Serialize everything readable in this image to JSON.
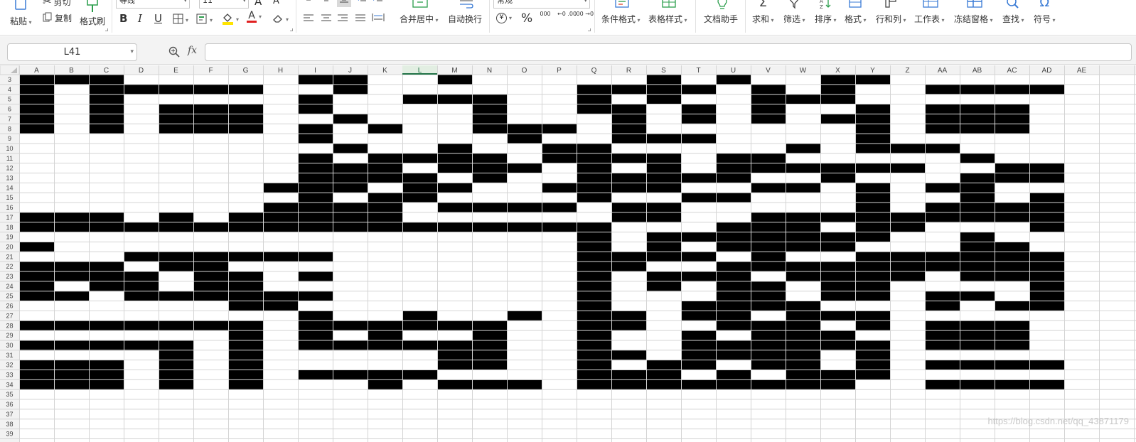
{
  "ribbon": {
    "clipboard": {
      "paste": "粘贴",
      "cut": "剪切",
      "copy": "复制",
      "format_painter": "格式刷"
    },
    "font": {
      "name": "等线",
      "size": "11",
      "bold": "B",
      "italic": "I",
      "underline": "U",
      "grow": "A",
      "shrink": "A",
      "color_letter": "A"
    },
    "align": {
      "merge_center": "合并居中",
      "wrap": "自动换行"
    },
    "number": {
      "format": "常规",
      "percent": "%",
      "thousands": "000",
      "inc_decimal": "←0 .00",
      "dec_decimal": ".00 →0"
    },
    "styles": {
      "conditional": "条件格式",
      "table_style": "表格样式"
    },
    "assistant": "文档助手",
    "editing": {
      "sum": "求和",
      "filter": "筛选",
      "sort": "排序",
      "format": "格式",
      "rows_cols": "行和列",
      "worksheet": "工作表",
      "freeze": "冻结窗格",
      "find": "查找",
      "symbol": "符号"
    },
    "accent_color": "#4a7bd0",
    "font_color": "#e02020",
    "fill_color": "#ffe400"
  },
  "formula_bar": {
    "name_box": "L41",
    "fx": "fx",
    "formula": ""
  },
  "sheet": {
    "columns": [
      "A",
      "B",
      "C",
      "D",
      "E",
      "F",
      "G",
      "H",
      "I",
      "J",
      "K",
      "L",
      "M",
      "N",
      "O",
      "P",
      "Q",
      "R",
      "S",
      "T",
      "U",
      "V",
      "W",
      "X",
      "Y",
      "Z",
      "AA",
      "AB",
      "AC",
      "AD",
      "AE"
    ],
    "first_row": 3,
    "last_row": 39,
    "active_column": "L",
    "filled_color": "#000000",
    "empty_color": "#ffffff",
    "grid_color": "#d4d4d4",
    "header_bg": "#f2f2f2",
    "filled_cells": {
      "3": [
        "A",
        "B",
        "C",
        "I",
        "J",
        "M",
        "S",
        "U",
        "X",
        "Y"
      ],
      "4": [
        "A",
        "C",
        "D",
        "E",
        "F",
        "G",
        "J",
        "Q",
        "R",
        "S",
        "T",
        "V",
        "X",
        "AA",
        "AB",
        "AC",
        "AD"
      ],
      "5": [
        "A",
        "C",
        "I",
        "L",
        "M",
        "N",
        "Q",
        "S",
        "V",
        "W",
        "X"
      ],
      "6": [
        "A",
        "C",
        "E",
        "F",
        "G",
        "I",
        "N",
        "Q",
        "R",
        "T",
        "V",
        "Y",
        "AA",
        "AB",
        "AC"
      ],
      "7": [
        "A",
        "C",
        "E",
        "F",
        "G",
        "J",
        "N",
        "R",
        "T",
        "V",
        "X",
        "Y",
        "AA",
        "AB",
        "AC"
      ],
      "8": [
        "A",
        "C",
        "E",
        "F",
        "G",
        "I",
        "K",
        "N",
        "O",
        "P",
        "R",
        "Y",
        "AA",
        "AB",
        "AC"
      ],
      "9": [
        "I",
        "O",
        "R",
        "S",
        "T",
        "Y"
      ],
      "10": [
        "J",
        "M",
        "P",
        "Q",
        "W",
        "Y",
        "Z",
        "AA"
      ],
      "11": [
        "I",
        "K",
        "L",
        "M",
        "N",
        "P",
        "Q",
        "R",
        "S",
        "U",
        "V",
        "AB"
      ],
      "12": [
        "I",
        "J",
        "K",
        "M",
        "N",
        "O",
        "Q",
        "S",
        "U",
        "V",
        "W",
        "X",
        "Y",
        "Z",
        "AC",
        "AD"
      ],
      "13": [
        "I",
        "J",
        "K",
        "L",
        "N",
        "Q",
        "R",
        "S",
        "T",
        "U",
        "X",
        "AB",
        "AC",
        "AD"
      ],
      "14": [
        "H",
        "I",
        "J",
        "L",
        "M",
        "P",
        "Q",
        "R",
        "S",
        "V",
        "W",
        "Y",
        "AA",
        "AB"
      ],
      "15": [
        "I",
        "K",
        "L",
        "Q",
        "T",
        "U",
        "Y",
        "AB",
        "AD"
      ],
      "16": [
        "H",
        "I",
        "J",
        "K",
        "M",
        "N",
        "O",
        "P",
        "R",
        "S",
        "Y",
        "AA",
        "AB",
        "AC",
        "AD"
      ],
      "17": [
        "A",
        "B",
        "C",
        "E",
        "G",
        "H",
        "I",
        "J",
        "K",
        "R",
        "S",
        "V",
        "W",
        "X",
        "Y",
        "Z",
        "AA",
        "AB",
        "AC",
        "AD"
      ],
      "18": [
        "A",
        "B",
        "C",
        "D",
        "E",
        "F",
        "G",
        "H",
        "I",
        "J",
        "K",
        "L",
        "M",
        "N",
        "O",
        "P",
        "Q",
        "U",
        "V",
        "W",
        "Y",
        "Z",
        "AD"
      ],
      "19": [
        "Q",
        "S",
        "T",
        "U",
        "V",
        "W",
        "X",
        "Y",
        "AB"
      ],
      "20": [
        "A",
        "Q",
        "S",
        "U",
        "V",
        "W",
        "X",
        "AB",
        "AC"
      ],
      "21": [
        "D",
        "E",
        "F",
        "G",
        "H",
        "I",
        "Q",
        "R",
        "S",
        "T",
        "V",
        "Y",
        "Z",
        "AA",
        "AB",
        "AC",
        "AD"
      ],
      "22": [
        "A",
        "B",
        "C",
        "E",
        "F",
        "Q",
        "R",
        "U",
        "V",
        "W",
        "X",
        "Y",
        "Z",
        "AA",
        "AB",
        "AC",
        "AD"
      ],
      "23": [
        "A",
        "B",
        "C",
        "D",
        "F",
        "G",
        "I",
        "Q",
        "S",
        "T",
        "U",
        "W",
        "X",
        "Y",
        "Z",
        "AB",
        "AC",
        "AD"
      ],
      "24": [
        "A",
        "C",
        "D",
        "F",
        "G",
        "Q",
        "S",
        "U",
        "V",
        "X",
        "Y",
        "AD"
      ],
      "25": [
        "A",
        "B",
        "D",
        "E",
        "F",
        "G",
        "H",
        "I",
        "Q",
        "U",
        "V",
        "X",
        "Y",
        "AA",
        "AB",
        "AD"
      ],
      "26": [
        "G",
        "H",
        "Q",
        "T",
        "U",
        "V",
        "W",
        "AA",
        "AC",
        "AD"
      ],
      "27": [
        "I",
        "L",
        "O",
        "Q",
        "R",
        "T",
        "U",
        "W",
        "X",
        "Y"
      ],
      "28": [
        "A",
        "B",
        "C",
        "D",
        "E",
        "F",
        "G",
        "I",
        "J",
        "K",
        "L",
        "M",
        "N",
        "Q",
        "R",
        "U",
        "V",
        "W",
        "Y",
        "AA",
        "AB",
        "AC"
      ],
      "29": [
        "G",
        "I",
        "K",
        "N",
        "Q",
        "T",
        "V",
        "W",
        "X",
        "AA",
        "AB",
        "AC"
      ],
      "30": [
        "A",
        "B",
        "C",
        "D",
        "E",
        "G",
        "I",
        "J",
        "K",
        "L",
        "M",
        "N",
        "Q",
        "T",
        "U",
        "V",
        "W",
        "X",
        "Y",
        "AA",
        "AB",
        "AC"
      ],
      "31": [
        "E",
        "G",
        "M",
        "N",
        "Q",
        "R",
        "T",
        "U",
        "V",
        "W",
        "Y"
      ],
      "32": [
        "A",
        "B",
        "C",
        "E",
        "G",
        "M",
        "N",
        "Q",
        "S",
        "T",
        "V",
        "W",
        "Y",
        "AA",
        "AB",
        "AC",
        "AD"
      ],
      "33": [
        "A",
        "B",
        "C",
        "E",
        "G",
        "I",
        "J",
        "K",
        "L",
        "Q",
        "R",
        "S",
        "U",
        "W",
        "X",
        "Y"
      ],
      "34": [
        "A",
        "B",
        "C",
        "E",
        "G",
        "K",
        "M",
        "N",
        "O",
        "Q",
        "R",
        "S",
        "T",
        "U",
        "V",
        "W",
        "X",
        "AA",
        "AB",
        "AC",
        "AD"
      ]
    }
  },
  "watermark": "https://blog.csdn.net/qq_43871179"
}
